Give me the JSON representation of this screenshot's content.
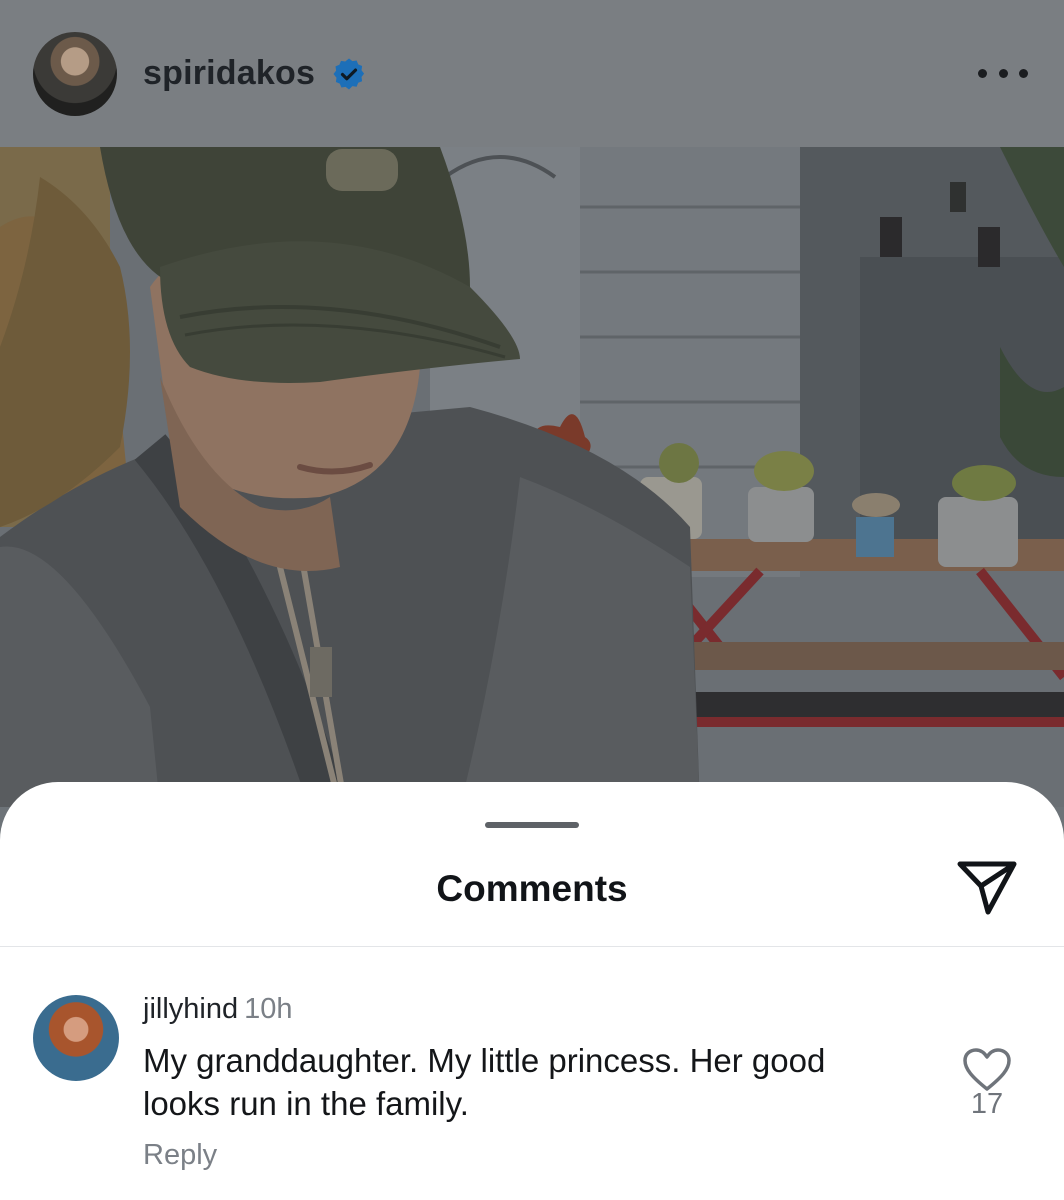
{
  "post": {
    "username": "spiridakos",
    "verified": true,
    "avatar_icon": "profile-avatar-with-dog",
    "more_icon": "more-horizontal-icon"
  },
  "photo": {
    "subject_icon": "post-photo"
  },
  "comments_sheet": {
    "title": "Comments",
    "share_icon": "paper-plane-icon",
    "comments": [
      {
        "username": "jillyhind",
        "time": "10h",
        "text": "My granddaughter. My little princess. Her good looks run in the family.",
        "reply_label": "Reply",
        "likes": "17",
        "like_icon": "heart-outline-icon"
      }
    ]
  },
  "colors": {
    "overlay_header": "#7a7e82",
    "verified_blue": "#1d6fb8",
    "sheet_bg": "#ffffff",
    "muted_text": "#7b8087"
  }
}
